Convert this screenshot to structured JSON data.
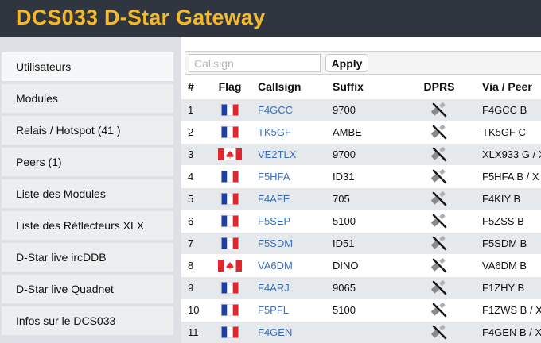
{
  "header": {
    "title": "DCS033 D-Star Gateway"
  },
  "sidebar": {
    "items": [
      {
        "label": "Utilisateurs",
        "name": "sidebar-item-utilisateurs"
      },
      {
        "label": "Modules",
        "name": "sidebar-item-modules"
      },
      {
        "label": "Relais / Hotspot (41 )",
        "name": "sidebar-item-relais-hotspot"
      },
      {
        "label": "Peers (1)",
        "name": "sidebar-item-peers"
      },
      {
        "label": "Liste des Modules",
        "name": "sidebar-item-liste-modules"
      },
      {
        "label": "Liste des Réflecteurs XLX",
        "name": "sidebar-item-liste-reflecteurs-xlx"
      },
      {
        "label": "D-Star live ircDDB",
        "name": "sidebar-item-dstar-live-ircddb"
      },
      {
        "label": "D-Star live Quadnet",
        "name": "sidebar-item-dstar-live-quadnet"
      },
      {
        "label": "Infos sur le DCS033",
        "name": "sidebar-item-infos-dcs033"
      }
    ]
  },
  "search": {
    "placeholder": "Callsign",
    "value": "",
    "apply_label": "Apply"
  },
  "table": {
    "columns": [
      "#",
      "Flag",
      "Callsign",
      "Suffix",
      "DPRS",
      "Via / Peer"
    ],
    "rows": [
      {
        "num": "1",
        "flag": "fr",
        "callsign": "F4GCC",
        "suffix": "9700",
        "dprs": "satellite",
        "via": "F4GCC B"
      },
      {
        "num": "2",
        "flag": "fr",
        "callsign": "TK5GF",
        "suffix": "AMBE",
        "dprs": "satellite",
        "via": "TK5GF C"
      },
      {
        "num": "3",
        "flag": "ca",
        "callsign": "VE2TLX",
        "suffix": "9700",
        "dprs": "satellite",
        "via": "XLX933 G / X"
      },
      {
        "num": "4",
        "flag": "fr",
        "callsign": "F5HFA",
        "suffix": "ID31",
        "dprs": "satellite",
        "via": "F5HFA B / X"
      },
      {
        "num": "5",
        "flag": "fr",
        "callsign": "F4AFE",
        "suffix": "705",
        "dprs": "satellite",
        "via": "F4KIY B"
      },
      {
        "num": "6",
        "flag": "fr",
        "callsign": "F5SEP",
        "suffix": "5100",
        "dprs": "satellite",
        "via": "F5ZSS B"
      },
      {
        "num": "7",
        "flag": "fr",
        "callsign": "F5SDM",
        "suffix": "ID51",
        "dprs": "satellite",
        "via": "F5SDM B"
      },
      {
        "num": "8",
        "flag": "ca",
        "callsign": "VA6DM",
        "suffix": "DINO",
        "dprs": "satellite",
        "via": "VA6DM B"
      },
      {
        "num": "9",
        "flag": "fr",
        "callsign": "F4ARJ",
        "suffix": "9065",
        "dprs": "satellite",
        "via": "F1ZHY B"
      },
      {
        "num": "10",
        "flag": "fr",
        "callsign": "F5PFL",
        "suffix": "5100",
        "dprs": "satellite",
        "via": "F1ZWS B / X"
      },
      {
        "num": "11",
        "flag": "fr",
        "callsign": "F4GEN",
        "suffix": "",
        "dprs": "satellite",
        "via": "F4GEN B / X"
      }
    ]
  },
  "colors": {
    "header_bg": "#2f3640",
    "title": "#f5b928",
    "link": "#3b6fb6",
    "row_alt": "#e6e9ec",
    "sidebar_bg": "#dde1e5"
  }
}
